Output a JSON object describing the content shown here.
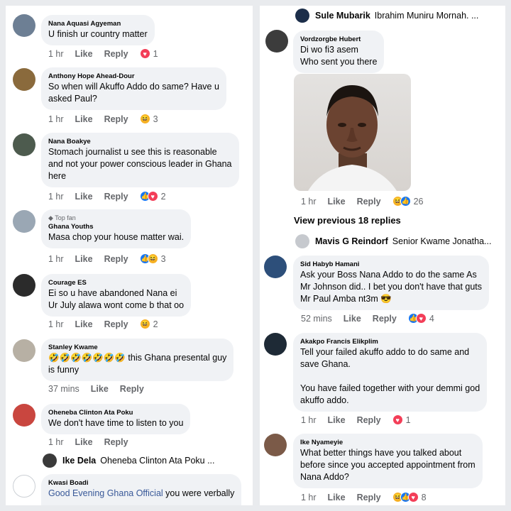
{
  "left": {
    "comments": [
      {
        "author": "Nana Aquasi Agyeman",
        "text": "U finish ur country matter",
        "time": "1 hr",
        "like": "Like",
        "reply": "Reply",
        "reactions": [
          "love"
        ],
        "count": "1"
      },
      {
        "author": "Anthony Hope Ahead-Dour",
        "text": "So when will Akuffo Addo do same? Have u\nasked Paul?",
        "time": "1 hr",
        "like": "Like",
        "reply": "Reply",
        "reactions": [
          "haha"
        ],
        "count": "3"
      },
      {
        "author": "Nana Boakye",
        "text": "Stomach journalist u see this is reasonable\nand not your power conscious leader in Ghana\nhere",
        "time": "1 hr",
        "like": "Like",
        "reply": "Reply",
        "reactions": [
          "like",
          "love"
        ],
        "count": "2"
      },
      {
        "badge": "Top fan",
        "author": "Ghana Youths",
        "text": "Masa chop your house matter wai.",
        "time": "1 hr",
        "like": "Like",
        "reply": "Reply",
        "reactions": [
          "like",
          "haha"
        ],
        "count": "3"
      },
      {
        "author": "Courage ES",
        "text": "Ei so u have abandoned Nana ei\nUr July alawa wont come b that oo",
        "time": "1 hr",
        "like": "Like",
        "reply": "Reply",
        "reactions": [
          "haha"
        ],
        "count": "2"
      },
      {
        "author": "Stanley Kwame",
        "text": "🤣🤣🤣🤣🤣🤣🤣 this Ghana presental guy\nis funny",
        "time": "37 mins",
        "like": "Like",
        "reply": "Reply"
      },
      {
        "author": "Oheneba Clinton Ata Poku",
        "text": "We don't have time to listen to you",
        "time": "1 hr",
        "like": "Like",
        "reply": "Reply"
      }
    ],
    "reply_preview": {
      "name": "Ike Dela",
      "text": "Oheneba Clinton Ata Poku ..."
    },
    "last_comment": {
      "author": "Kwasi Boadi",
      "mention": "Good Evening Ghana Official",
      "text": " you were verbally"
    }
  },
  "right": {
    "reply_preview_top": {
      "name": "Sule Mubarik",
      "text": "Ibrahim Muniru Mornah. ..."
    },
    "vord": {
      "author": "Vordzorgbe Hubert",
      "text": "Di wo fi3 asem\nWho sent you there",
      "time": "1 hr",
      "like": "Like",
      "reply": "Reply",
      "count": "26"
    },
    "view_previous": "View previous 18 replies",
    "reply_preview_mid": {
      "name": "Mavis G Reindorf",
      "text": "Senior Kwame Jonatha..."
    },
    "comments": [
      {
        "author": "Sid Habyb Hamani",
        "text": "Ask your Boss Nana Addo to do the same As\nMr Johnson did.. I bet you don't have that guts\nMr Paul Amba nt3m 😎",
        "time": "52 mins",
        "like": "Like",
        "reply": "Reply",
        "reactions": [
          "like",
          "love"
        ],
        "count": "4"
      },
      {
        "author": "Akakpo Francis Elikplim",
        "text": "Tell your failed akuffo addo to do same and\nsave Ghana.\n\nYou have failed together with your demmi god\nakuffo addo.",
        "time": "1 hr",
        "like": "Like",
        "reply": "Reply",
        "reactions": [
          "love"
        ],
        "count": "1"
      },
      {
        "author": "Ike Nyameyie",
        "text": "What better things have you talked about\nbefore since you accepted appointment from\nNana Addo?",
        "time": "1 hr",
        "like": "Like",
        "reply": "Reply",
        "reactions": [
          "haha",
          "like",
          "love"
        ],
        "count": "8"
      }
    ]
  },
  "colors": {
    "bubble": "#f0f2f5",
    "like": "#1877f2",
    "love": "#f33e58",
    "haha": "#f7b125",
    "meta": "#65676b",
    "link": "#385898"
  }
}
